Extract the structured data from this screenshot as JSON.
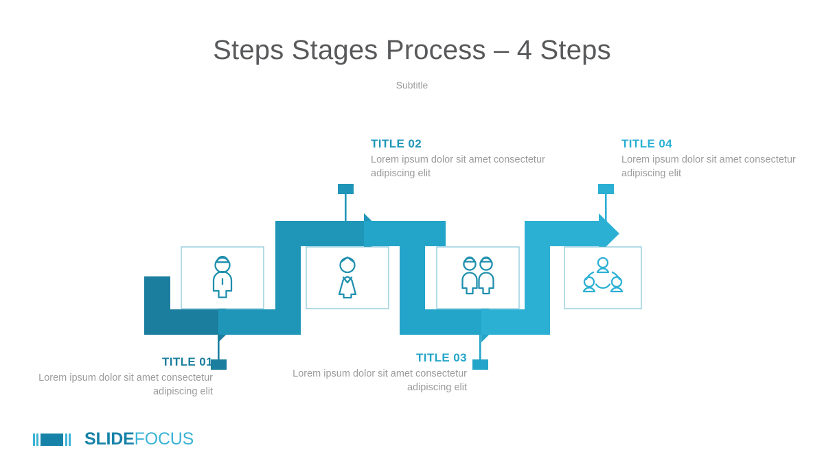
{
  "header": {
    "title": "Steps Stages Process – 4 Steps",
    "subtitle": "Subtitle"
  },
  "colors": {
    "segment_1": "#1b7e9e",
    "segment_2": "#1f96b8",
    "segment_3": "#22a5c8",
    "segment_4": "#2bb0d4",
    "title_text": "#58595b",
    "body_text": "#9b9b9b",
    "icon_stroke": "#1f8fae",
    "box_border": "#6ab8cf",
    "logo_dark": "#1682a8",
    "logo_light": "#3bb3d6"
  },
  "steps": [
    {
      "number": "01",
      "title": "TITLE 01",
      "description": "Lorem ipsum dolor sit amet consectetur adipiscing elit",
      "icon": "person-single-icon",
      "color": "#1b7e9e",
      "label_position": "bottom"
    },
    {
      "number": "02",
      "title": "TITLE 02",
      "description": "Lorem ipsum dolor sit amet consectetur adipiscing elit",
      "icon": "person-female-icon",
      "color": "#1f96b8",
      "label_position": "top"
    },
    {
      "number": "03",
      "title": "TITLE 03",
      "description": "Lorem ipsum dolor sit amet consectetur adipiscing elit",
      "icon": "two-people-icon",
      "color": "#22a5c8",
      "label_position": "bottom"
    },
    {
      "number": "04",
      "title": "TITLE 04",
      "description": "Lorem ipsum dolor sit amet consectetur adipiscing elit",
      "icon": "team-network-icon",
      "color": "#2bb0d4",
      "label_position": "top"
    }
  ],
  "logo": {
    "word_primary": "SLIDE",
    "word_secondary": "FOCUS",
    "mark": "film-strip-icon"
  }
}
